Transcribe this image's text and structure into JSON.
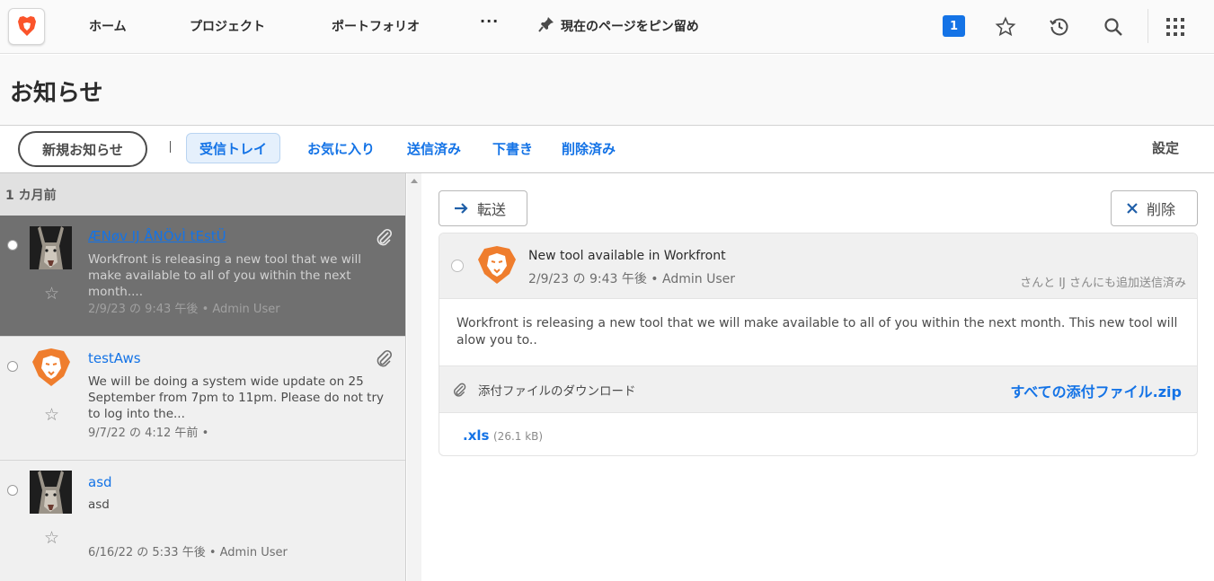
{
  "nav": {
    "items": [
      {
        "label": "ホーム"
      },
      {
        "label": "プロジェクト"
      },
      {
        "label": "ポートフォリオ"
      }
    ],
    "more_label": "···",
    "pin_label": "現在のページをピン留め",
    "notification_count": "1",
    "brand_color": "#1473e6",
    "icons": [
      "brand-logo-icon",
      "pin-icon",
      "star-icon",
      "history-icon",
      "search-icon",
      "app-grid-icon"
    ]
  },
  "page": {
    "title": "お知らせ"
  },
  "toolbar": {
    "new_label": "新規お知らせ",
    "tabs": [
      {
        "label": "受信トレイ",
        "active": true
      },
      {
        "label": "お気に入り"
      },
      {
        "label": "送信済み"
      },
      {
        "label": "下書き"
      },
      {
        "label": "削除済み"
      }
    ],
    "settings_label": "設定"
  },
  "list": {
    "group_label": "1 カ月前",
    "messages": [
      {
        "title": "ÆNøv IJ ÅNÖvÌ tEstÜ",
        "body": "Workfront is releasing a new tool that we will make available to all of you within the next month....",
        "meta": "2/9/23 の 9:43 午後 • Admin User",
        "selected": true,
        "avatar": "photo",
        "attachment": true
      },
      {
        "title": "testAws",
        "body": "We will be doing a system wide update on 25 September from 7pm to 11pm. Please do not try to log into the...",
        "meta": "9/7/22 の 4:12 午前 •",
        "avatar": "lion",
        "attachment": true
      },
      {
        "title": "asd",
        "body": "asd",
        "meta": "6/16/22 の 5:33 午後 • Admin User",
        "avatar": "photo",
        "attachment": false
      }
    ]
  },
  "detail": {
    "forward_label": "転送",
    "delete_label": "削除",
    "title": "New tool available in Workfront",
    "meta": "2/9/23 の 9:43 午後 • Admin User",
    "cc": "さんと IJ さんにも追加送信済み",
    "body": "Workfront is releasing a new tool that we will make available to all of you within the next month. This new tool will alow you to..",
    "attachments_label": "添付ファイルのダウンロード",
    "zip_label": "すべての添付ファイル.zip",
    "file_name": ".xls",
    "file_size": "(26.1 kB)"
  }
}
